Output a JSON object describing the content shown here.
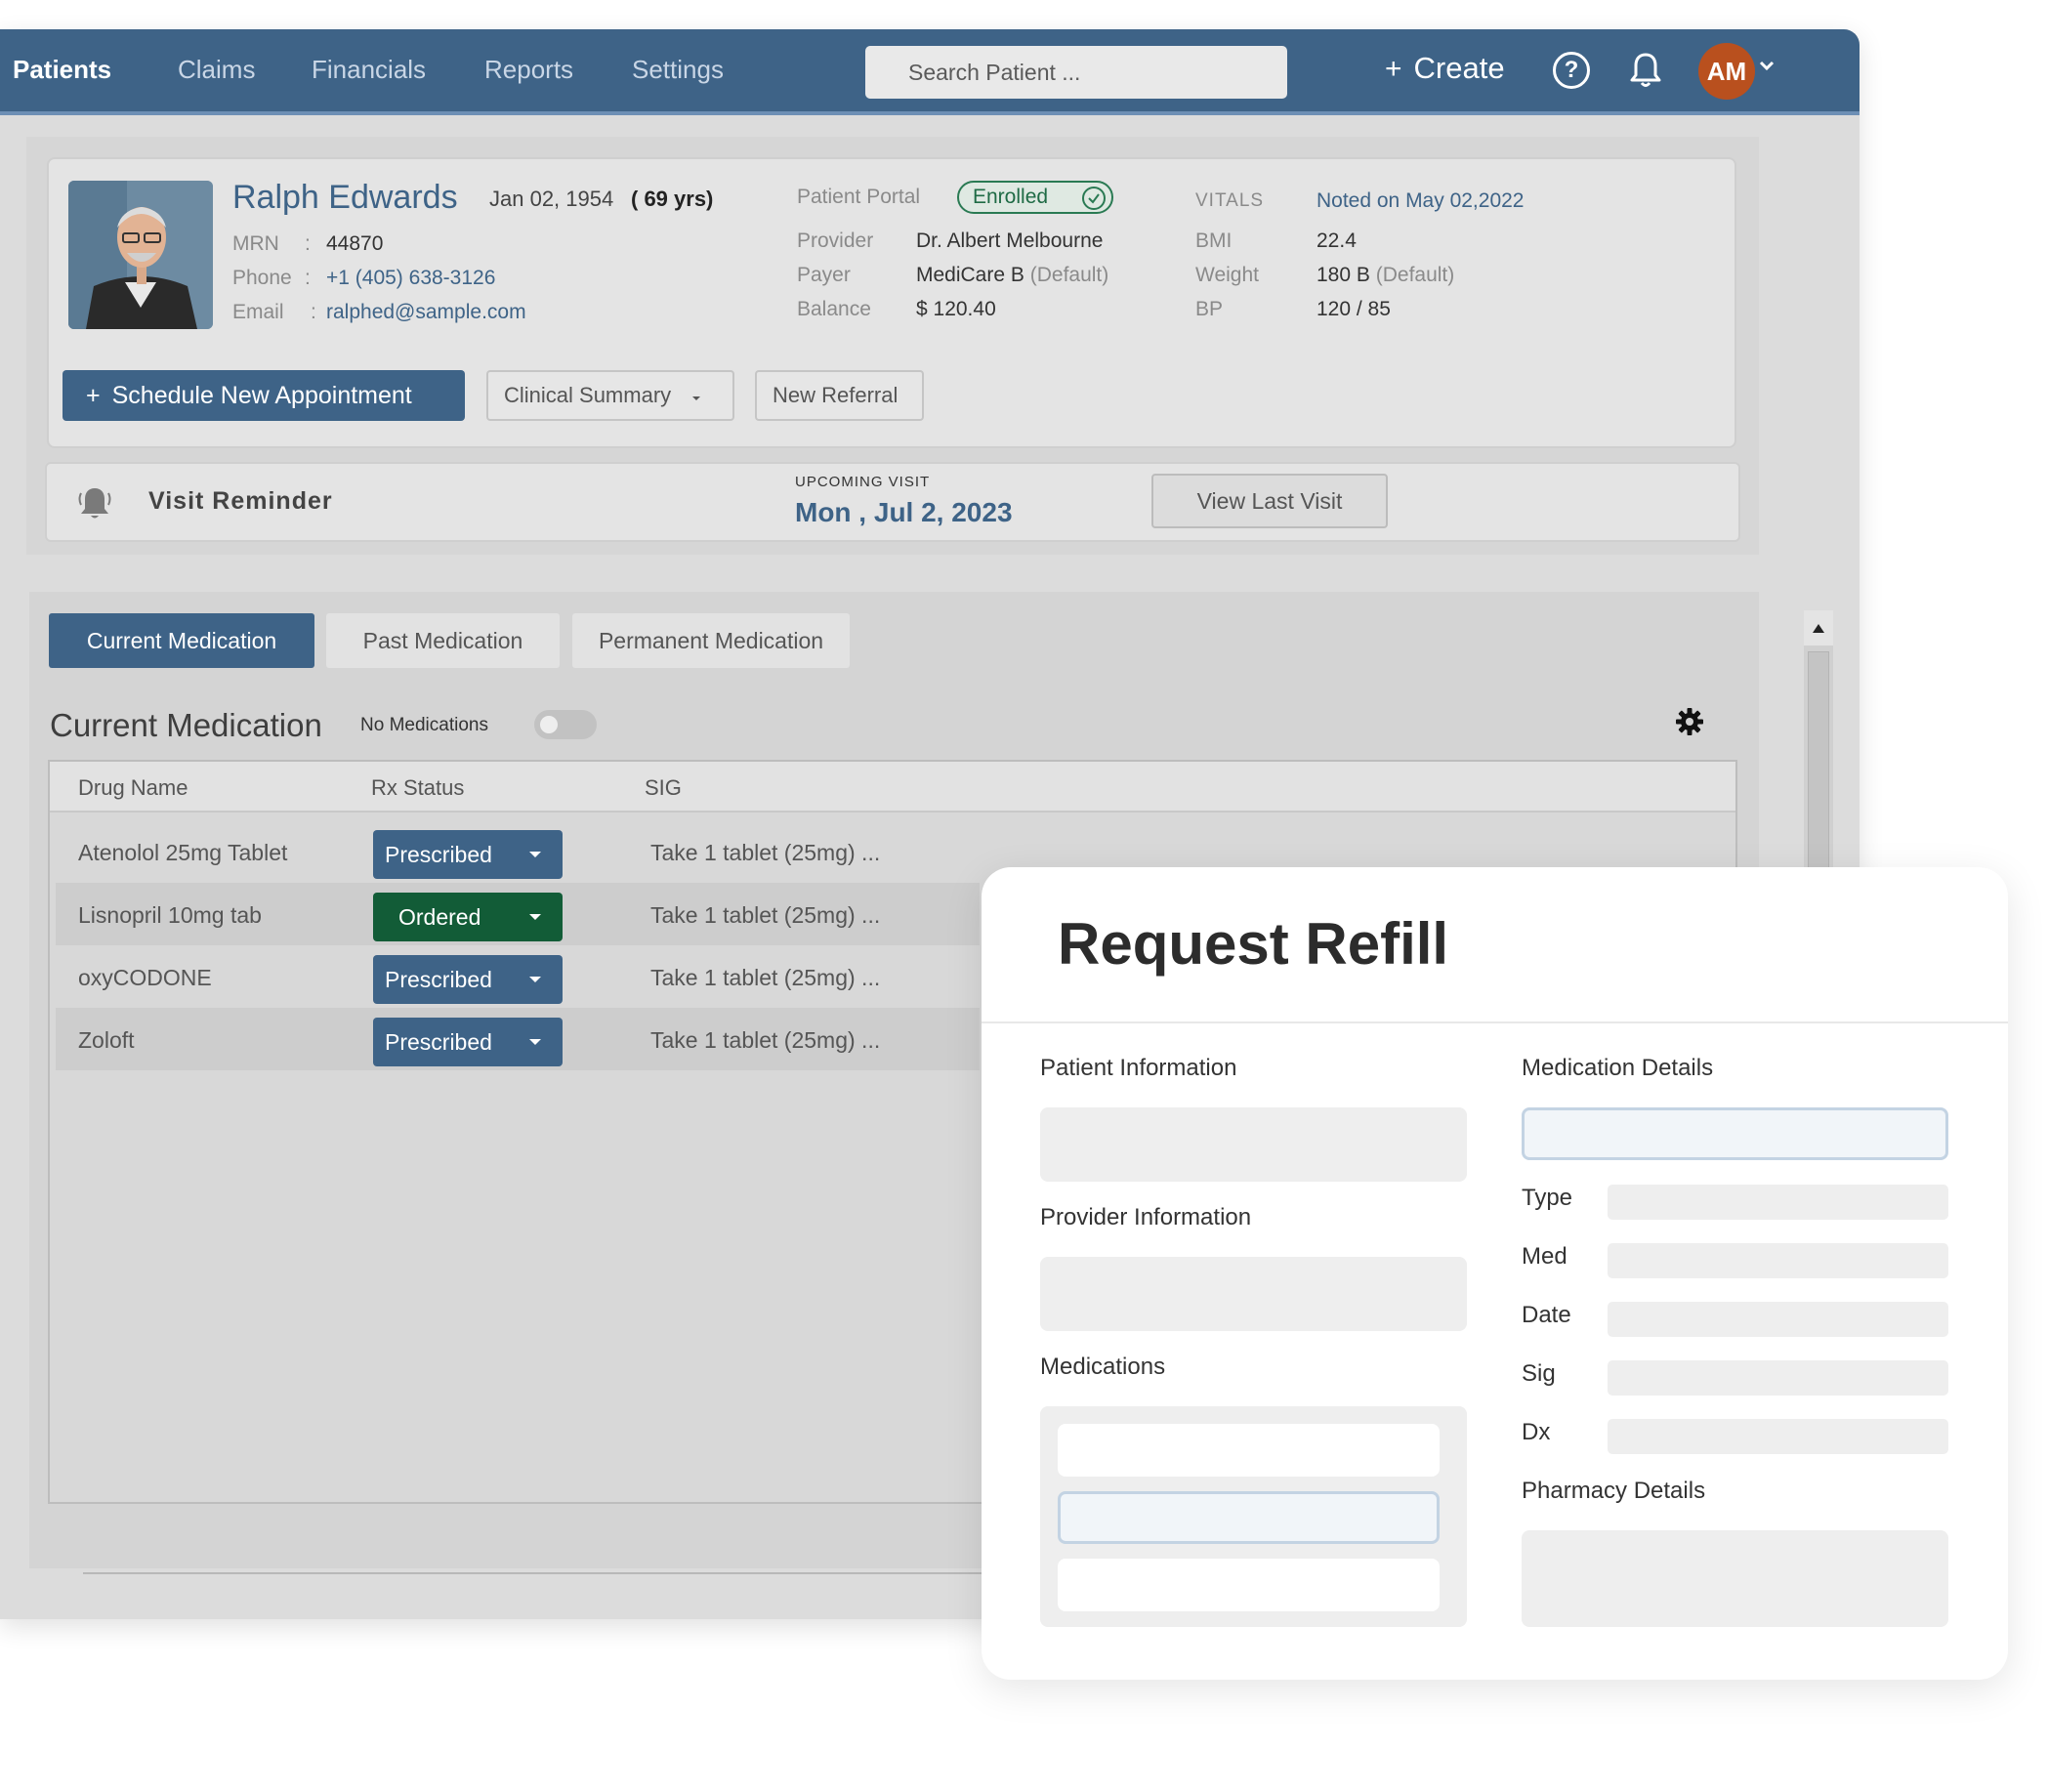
{
  "nav": {
    "items": [
      "Patients",
      "Claims",
      "Financials",
      "Reports",
      "Settings"
    ],
    "search_placeholder": "Search Patient ...",
    "create_label": "Create",
    "avatar_initials": "AM"
  },
  "patient": {
    "name": "Ralph Edwards",
    "dob": "Jan 02, 1954",
    "age": "( 69 yrs)",
    "mrn_label": "MRN",
    "mrn": "44870",
    "phone_label": "Phone",
    "phone": "+1 (405) 638-3126",
    "email_label": "Email",
    "email": "ralphed@sample.com",
    "portal_label": "Patient Portal",
    "portal_status": "Enrolled",
    "provider_label": "Provider",
    "provider": "Dr. Albert Melbourne",
    "payer_label": "Payer",
    "payer": "MediCare B",
    "payer_note": "(Default)",
    "balance_label": "Balance",
    "balance": "$ 120.40"
  },
  "vitals": {
    "label": "VITALS",
    "noted": "Noted on May 02,2022",
    "bmi_label": "BMI",
    "bmi": "22.4",
    "weight_label": "Weight",
    "weight": "180 B",
    "weight_note": "(Default)",
    "bp_label": "BP",
    "bp": "120 / 85"
  },
  "actions": {
    "schedule": "Schedule New Appointment",
    "clinical_summary": "Clinical Summary",
    "new_referral": "New Referral"
  },
  "reminder": {
    "title": "Visit Reminder",
    "upcoming_label": "UPCOMING VISIT",
    "date": "Mon , Jul 2, 2023",
    "view_last": "View Last Visit"
  },
  "medication": {
    "tabs": [
      "Current Medication",
      "Past Medication",
      "Permanent Medication"
    ],
    "active_tab": "Current Medication",
    "section_title": "Current Medication",
    "no_meds_label": "No Medications",
    "columns": [
      "Drug Name",
      "Rx Status",
      "SIG"
    ],
    "rows": [
      {
        "drug": "Atenolol 25mg Tablet",
        "status": "Prescribed",
        "sig": "Take 1 tablet (25mg) ..."
      },
      {
        "drug": "Lisnopril 10mg tab",
        "status": "Ordered",
        "sig": "Take 1 tablet (25mg) ..."
      },
      {
        "drug": "oxyCODONE",
        "status": "Prescribed",
        "sig": "Take 1 tablet (25mg) ..."
      },
      {
        "drug": "Zoloft",
        "status": "Prescribed",
        "sig": "Take 1 tablet (25mg) ..."
      }
    ]
  },
  "modal": {
    "title": "Request Refill",
    "patient_info": "Patient Information",
    "provider_info": "Provider Information",
    "medications": "Medications",
    "medication_details": "Medication Details",
    "fields": [
      "Type",
      "Med",
      "Date",
      "Sig",
      "Dx"
    ],
    "pharmacy_details": "Pharmacy Details"
  },
  "colors": {
    "brand": "#3e6387",
    "ordered": "#125c37",
    "avatar": "#b9501e",
    "enrolled": "#2a7a53"
  },
  "icons": [
    "plus-icon",
    "help-icon",
    "bell-icon",
    "chevron-down-icon",
    "check-icon",
    "gear-icon",
    "caret-down-icon",
    "scroll-up-icon"
  ]
}
